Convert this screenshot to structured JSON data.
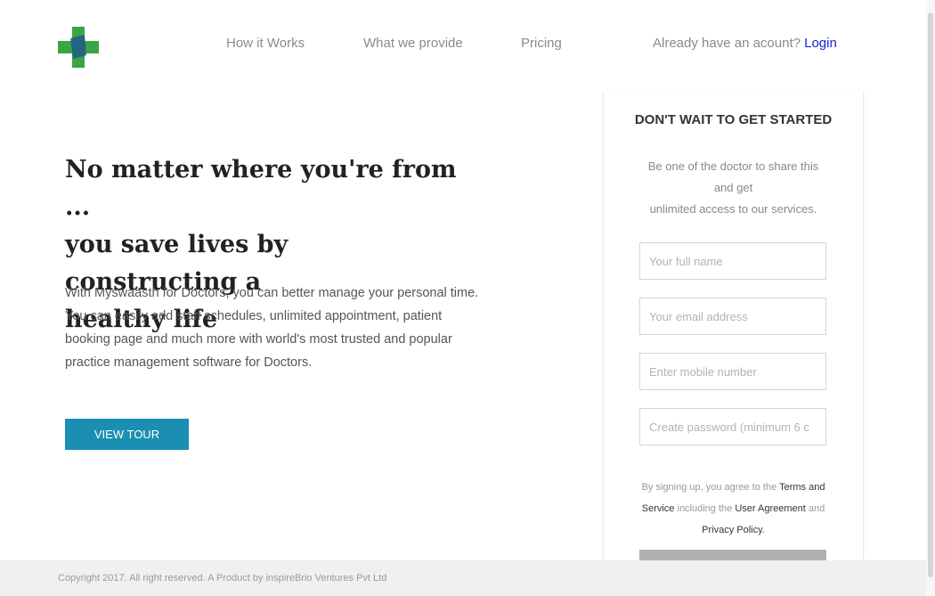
{
  "brand": {
    "logo_icon": "medical-cross-icon",
    "colors": {
      "green": "#3aa544",
      "blue": "#1f5a8a",
      "accent": "#1b8fb2",
      "link": "#1a23d6"
    }
  },
  "nav": {
    "items": [
      {
        "label": "How it Works"
      },
      {
        "label": "What we provide"
      },
      {
        "label": "Pricing"
      }
    ],
    "account_prompt": "Already have an acount? ",
    "login_label": "Login"
  },
  "hero": {
    "title_lines": [
      "No matter where you're from ...",
      "you save lives by constructing a",
      "healthy life"
    ],
    "description": "With Myswaasth for Doctors, you can better manage your personal time. You can easily add staff schedules, unlimited appointment, patient booking page and much more with world's most trusted and popular practice management software for Doctors.",
    "tour_button": "VIEW TOUR"
  },
  "signup": {
    "title": "DON'T WAIT TO GET STARTED",
    "subtitle_lines": [
      "Be one of the doctor to share this and get",
      "unlimited access to our services."
    ],
    "fields": {
      "name_placeholder": "Your full name",
      "email_placeholder": "Your email address",
      "mobile_placeholder": "Enter mobile number",
      "password_placeholder": "Create password (minimum 6 c"
    },
    "terms": {
      "prefix": "By signing up, you agree to the ",
      "terms_link": "Terms and Service",
      "middle": " including the ",
      "agreement_link": "User Agreement",
      "and": " and ",
      "privacy_link": "Privacy Policy."
    }
  },
  "footer": {
    "copyright": "Copyright 2017. All right reserved. A Product by inspireBrio Ventures Pvt Ltd"
  }
}
